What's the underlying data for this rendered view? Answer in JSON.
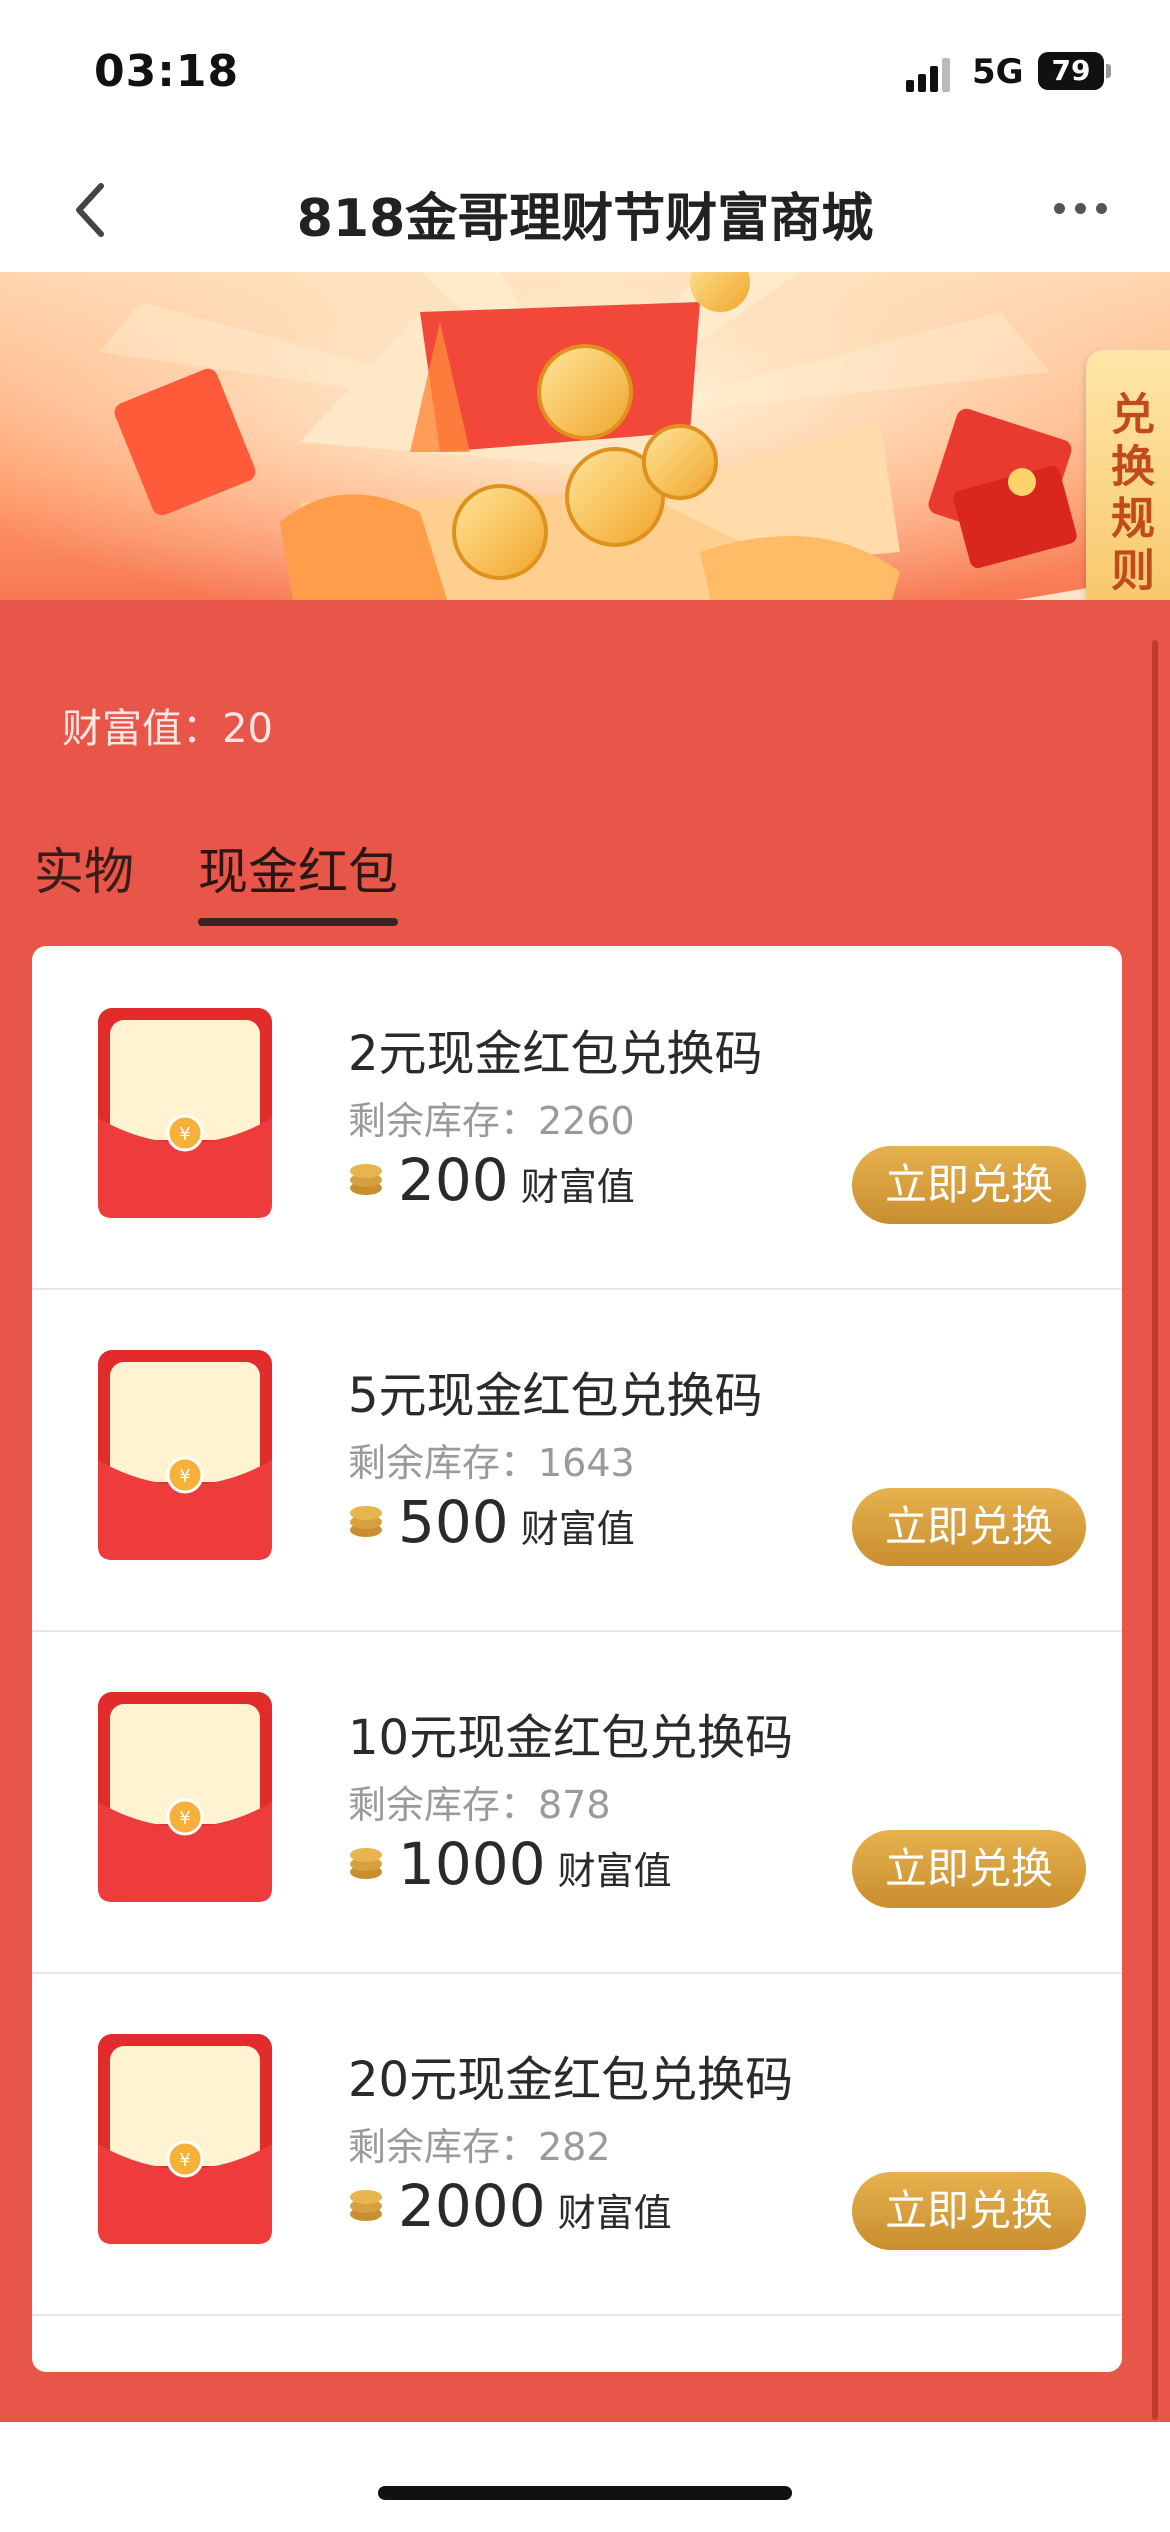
{
  "status": {
    "time": "03:18",
    "network": "5G",
    "battery": "79"
  },
  "nav": {
    "title": "818金哥理财节财富商城"
  },
  "rules_tab": "兑换规则",
  "wealth": {
    "label": "财富值：20"
  },
  "tabs": [
    {
      "label": "实物"
    },
    {
      "label": "现金红包"
    }
  ],
  "items": [
    {
      "title": "2元现金红包兑换码",
      "stock": "剩余库存：2260",
      "price": "200",
      "unit": "财富值",
      "button": "立即兑换"
    },
    {
      "title": "5元现金红包兑换码",
      "stock": "剩余库存：1643",
      "price": "500",
      "unit": "财富值",
      "button": "立即兑换"
    },
    {
      "title": "10元现金红包兑换码",
      "stock": "剩余库存：878",
      "price": "1000",
      "unit": "财富值",
      "button": "立即兑换"
    },
    {
      "title": "20元现金红包兑换码",
      "stock": "剩余库存：282",
      "price": "2000",
      "unit": "财富值",
      "button": "立即兑换"
    }
  ],
  "colors": {
    "panel": "#e8564a",
    "button": "#d39e3d",
    "envelope": "#e22b2b"
  }
}
